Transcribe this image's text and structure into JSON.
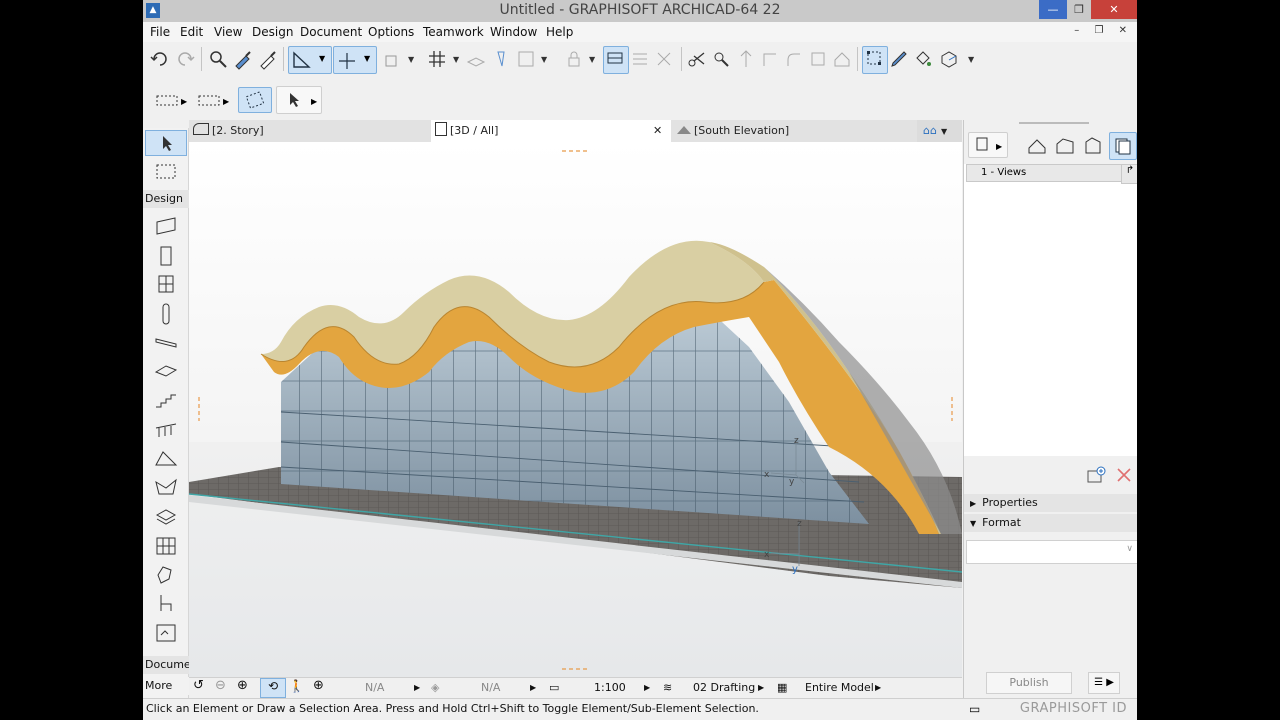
{
  "window": {
    "title": "Untitled - GRAPHISOFT ARCHICAD-64 22",
    "icon": "archicad-logo-icon"
  },
  "menu": [
    "File",
    "Edit",
    "View",
    "Design",
    "Document",
    "Options",
    "Teamwork",
    "Window",
    "Help"
  ],
  "toolbox": {
    "design_label": "Design",
    "document_label": "Docume",
    "more_label": "More"
  },
  "tabs": [
    {
      "label": "[2. Story]",
      "icon": "floor-plan-icon"
    },
    {
      "label": "[3D / All]",
      "icon": "3d-icon",
      "active": true
    },
    {
      "label": "[South Elevation]",
      "icon": "elevation-icon"
    }
  ],
  "navigator": {
    "views_label": "1 - Views",
    "properties_label": "Properties",
    "format_label": "Format",
    "publish_label": "Publish"
  },
  "navbar": {
    "scale_value": "1:100",
    "layer_combo": "02 Drafting",
    "model_view": "Entire Model",
    "na_1": "N/A",
    "na_2": "N/A"
  },
  "status": {
    "message": "Click an Element or Draw a Selection Area. Press and Hold Ctrl+Shift to Toggle Element/Sub-Element Selection.",
    "brand": "GRAPHISOFT ID"
  },
  "colors": {
    "roof_orange": "#e0a43c",
    "roof_top": "#ddd0a0",
    "glass": "#9aafbf",
    "slab": "#6f6c69",
    "selection_blue": "#cfe3f6"
  }
}
